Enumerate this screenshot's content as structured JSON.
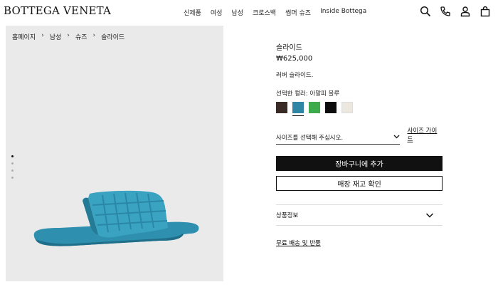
{
  "header": {
    "logo": "BOTTEGA VENETA",
    "nav": [
      "신제품",
      "여성",
      "남성",
      "크로스백",
      "썸머 슈즈",
      "Inside Bottega"
    ],
    "icons": [
      "search-icon",
      "phone-icon",
      "account-icon",
      "bag-icon"
    ]
  },
  "breadcrumb": [
    "홈페이지",
    "남성",
    "슈즈",
    "슬라이드"
  ],
  "gallery": {
    "slide_count": 4,
    "active_index": 0
  },
  "product": {
    "name": "슬라이드",
    "price": "₩625,000",
    "description": "러버 슬라이드.",
    "color_label": "선택한 컬러: 아말피 블루",
    "swatches": [
      {
        "name": "brown",
        "color": "#3a2a26"
      },
      {
        "name": "amalfi-blue",
        "color": "#2f87a5",
        "selected": true
      },
      {
        "name": "green",
        "color": "#3daa4c"
      },
      {
        "name": "black",
        "color": "#0c0c0c"
      },
      {
        "name": "cream",
        "color": "#ece8df"
      }
    ],
    "size_placeholder": "사이즈를 선택해 주십시오.",
    "size_guide": "사이즈 가이드",
    "add_to_cart": "장바구니에 추가",
    "check_store": "매장 재고 확인",
    "info_label": "상품정보",
    "shipping_link": "무료 배송 및 반품"
  }
}
